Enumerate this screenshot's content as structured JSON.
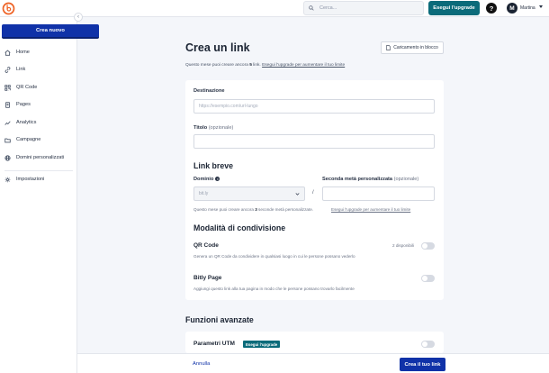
{
  "topbar": {
    "search_placeholder": "Cerca...",
    "upgrade_label": "Esegui l'upgrade",
    "help": "?",
    "avatar_initial": "M",
    "user_name": "Martina"
  },
  "sidebar": {
    "create_new": "Crea nuovo",
    "collapse": "‹",
    "items": [
      {
        "label": "Home",
        "icon": "home-icon"
      },
      {
        "label": "Link",
        "icon": "link-icon"
      },
      {
        "label": "QR Code",
        "icon": "qr-code-icon"
      },
      {
        "label": "Pages",
        "icon": "pages-icon"
      },
      {
        "label": "Analytics",
        "icon": "analytics-icon"
      },
      {
        "label": "Campagne",
        "icon": "campaigns-icon"
      },
      {
        "label": "Domini personalizzati",
        "icon": "globe-icon"
      },
      {
        "label": "Impostazioni",
        "icon": "gear-icon"
      }
    ]
  },
  "main": {
    "title": "Crea un link",
    "bulk_upload": "Caricamento in blocco",
    "quota": {
      "prefix": "Questo mese puoi creare ancora ",
      "count": "5",
      "suffix": " link. ",
      "upgrade_link": "Esegui l'upgrade per aumentare il tuo limite"
    },
    "destination": {
      "label": "Destinazione",
      "placeholder": "https://esempio.com/url-lungo"
    },
    "title_field": {
      "label": "Titolo",
      "optional": "(opzionale)"
    },
    "short_link": {
      "heading": "Link breve",
      "domain_label": "Dominio",
      "domain_value": "bit.ly",
      "back_half_label": "Seconda metà personalizzata",
      "back_half_optional": "(opzionale)",
      "slash": "/",
      "quota_prefix": "Questo mese puoi creare ancora ",
      "quota_count": "3",
      "quota_suffix": " seconde metà personalizzate.",
      "upgrade_link": "Esegui l'upgrade per aumentare il tuo limite"
    },
    "sharing": {
      "heading": "Modalità di condivisione",
      "qr_title": "QR Code",
      "qr_available": "2 disponibili",
      "qr_desc": "Genera un QR Code da condividere in qualsiasi luogo in cui le persone possano vederlo",
      "page_title": "Bitly Page",
      "page_desc": "Aggiungi questo link alla tua pagina in modo che le persone possano trovarlo facilmente"
    },
    "advanced": {
      "heading": "Funzioni avanzate",
      "utm_title": "Parametri UTM",
      "utm_badge": "Esegui l'upgrade"
    }
  },
  "footer": {
    "cancel": "Annulla",
    "create": "Crea il tuo link"
  }
}
